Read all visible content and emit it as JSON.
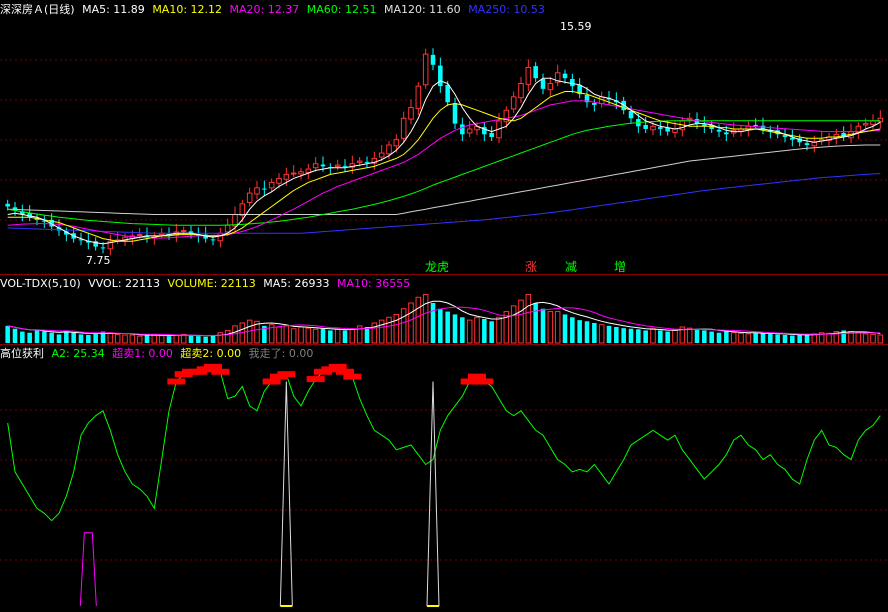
{
  "price_panel": {
    "title": "深深房Ａ(日线)",
    "legend": [
      {
        "label": "MA5: 11.89",
        "color": "#ffffff"
      },
      {
        "label": "MA10: 12.12",
        "color": "#ffff00"
      },
      {
        "label": "MA20: 12.37",
        "color": "#ff00ff"
      },
      {
        "label": "MA60: 12.51",
        "color": "#00ff00"
      },
      {
        "label": "MA120: 11.60",
        "color": "#e0e0e0"
      },
      {
        "label": "MA250: 10.53",
        "color": "#3333ff"
      }
    ],
    "annotations": {
      "high": "15.59",
      "low": "7.75"
    },
    "tags": [
      {
        "label": "龙虎",
        "color": "#00ff00"
      },
      {
        "label": "涨",
        "color": "#ff3333"
      },
      {
        "label": "减",
        "color": "#00ff00"
      },
      {
        "label": "增",
        "color": "#00ff00"
      }
    ]
  },
  "volume_panel": {
    "legend": [
      {
        "label": "VOL-TDX(5,10)",
        "color": "#ffffff"
      },
      {
        "label": "VVOL: 22113",
        "color": "#ffffff"
      },
      {
        "label": "VOLUME: 22113",
        "color": "#ffff00"
      },
      {
        "label": "MA5: 26933",
        "color": "#ffffff"
      },
      {
        "label": "MA10: 36555",
        "color": "#ff00ff"
      }
    ]
  },
  "indicator_panel": {
    "legend": [
      {
        "label": "高位获利",
        "color": "#ffffff"
      },
      {
        "label": "A2: 25.34",
        "color": "#00ff00"
      },
      {
        "label": "超卖1: 0.00",
        "color": "#ff00ff"
      },
      {
        "label": "超卖2: 0.00",
        "color": "#ffff00"
      },
      {
        "label": "我走了: 0.00",
        "color": "#808080"
      }
    ]
  },
  "chart_data": {
    "type": "candlestick",
    "price_range": [
      7.0,
      16.2
    ],
    "bars": 120,
    "close": [
      9.3,
      9.15,
      9.0,
      8.9,
      8.8,
      8.75,
      8.55,
      8.4,
      8.25,
      8.1,
      8.05,
      7.95,
      7.8,
      7.75,
      8.0,
      8.05,
      8.15,
      8.2,
      8.25,
      8.15,
      8.2,
      8.3,
      8.25,
      8.35,
      8.4,
      8.3,
      8.2,
      8.1,
      8.05,
      8.3,
      8.6,
      9.0,
      9.4,
      9.8,
      10.0,
      9.95,
      10.2,
      10.35,
      10.5,
      10.55,
      10.6,
      10.7,
      10.9,
      10.8,
      10.75,
      10.85,
      10.8,
      10.9,
      11.0,
      10.95,
      11.1,
      11.3,
      11.6,
      11.8,
      12.6,
      13.0,
      13.8,
      15.0,
      14.6,
      13.8,
      13.2,
      12.4,
      12.0,
      12.2,
      12.3,
      12.0,
      11.9,
      12.5,
      12.9,
      13.4,
      13.9,
      14.5,
      14.1,
      13.7,
      13.9,
      14.3,
      14.1,
      13.8,
      13.5,
      13.2,
      13.1,
      13.4,
      13.3,
      13.2,
      12.9,
      12.6,
      12.3,
      12.2,
      12.3,
      12.2,
      12.1,
      12.2,
      12.5,
      12.6,
      12.4,
      12.3,
      12.2,
      12.1,
      12.0,
      12.15,
      12.2,
      12.3,
      12.35,
      12.2,
      12.1,
      12.0,
      11.9,
      11.8,
      11.7,
      11.6,
      11.7,
      11.8,
      11.9,
      12.0,
      11.9,
      12.1,
      12.3,
      12.4,
      12.5,
      12.6
    ],
    "ma5": [
      9.0,
      9.05,
      9.0,
      8.95,
      8.9,
      8.8,
      8.65,
      8.5,
      8.35,
      8.2,
      8.1,
      8.0,
      7.95,
      7.9,
      7.95,
      8.0,
      8.05,
      8.1,
      8.15,
      8.2,
      8.2,
      8.2,
      8.25,
      8.3,
      8.3,
      8.3,
      8.25,
      8.2,
      8.15,
      8.2,
      8.3,
      8.5,
      8.8,
      9.2,
      9.5,
      9.7,
      9.85,
      10.05,
      10.2,
      10.35,
      10.45,
      10.55,
      10.65,
      10.7,
      10.75,
      10.75,
      10.75,
      10.8,
      10.85,
      10.9,
      10.95,
      11.05,
      11.2,
      11.4,
      11.7,
      12.1,
      12.6,
      13.3,
      13.8,
      14.0,
      13.9,
      13.5,
      13.0,
      12.6,
      12.3,
      12.2,
      12.1,
      12.2,
      12.3,
      12.6,
      13.0,
      13.5,
      13.9,
      14.1,
      14.1,
      14.0,
      13.95,
      13.9,
      13.85,
      13.7,
      13.5,
      13.4,
      13.35,
      13.25,
      13.1,
      12.9,
      12.7,
      12.5,
      12.4,
      12.3,
      12.25,
      12.2,
      12.25,
      12.35,
      12.4,
      12.4,
      12.35,
      12.25,
      12.15,
      12.1,
      12.1,
      12.15,
      12.2,
      12.2,
      12.15,
      12.1,
      12.0,
      11.9,
      11.8,
      11.75,
      11.7,
      11.75,
      11.8,
      11.85,
      11.9,
      11.95,
      12.05,
      12.2,
      12.3,
      12.45
    ],
    "ma10": [
      8.9,
      8.9,
      8.9,
      8.9,
      8.85,
      8.8,
      8.75,
      8.7,
      8.6,
      8.5,
      8.4,
      8.3,
      8.2,
      8.1,
      8.05,
      8.0,
      8.0,
      8.0,
      8.05,
      8.1,
      8.15,
      8.2,
      8.2,
      8.25,
      8.25,
      8.25,
      8.25,
      8.2,
      8.2,
      8.2,
      8.25,
      8.35,
      8.5,
      8.7,
      8.9,
      9.1,
      9.3,
      9.5,
      9.7,
      9.9,
      10.05,
      10.2,
      10.3,
      10.4,
      10.5,
      10.55,
      10.6,
      10.65,
      10.7,
      10.75,
      10.8,
      10.9,
      11.0,
      11.1,
      11.25,
      11.5,
      11.8,
      12.2,
      12.6,
      12.9,
      13.1,
      13.15,
      13.1,
      13.0,
      12.9,
      12.8,
      12.7,
      12.6,
      12.55,
      12.5,
      12.6,
      12.8,
      13.0,
      13.2,
      13.4,
      13.5,
      13.6,
      13.6,
      13.55,
      13.5,
      13.4,
      13.3,
      13.2,
      13.1,
      13.0,
      12.9,
      12.8,
      12.7,
      12.6,
      12.5,
      12.45,
      12.4,
      12.35,
      12.3,
      12.3,
      12.3,
      12.3,
      12.25,
      12.25,
      12.2,
      12.2,
      12.2,
      12.2,
      12.15,
      12.1,
      12.05,
      12.0,
      11.95,
      11.9,
      11.85,
      11.85,
      11.85,
      11.9,
      11.9,
      11.95,
      12.0,
      12.05,
      12.1,
      12.15,
      12.2
    ],
    "ma20": [
      8.6,
      8.62,
      8.64,
      8.65,
      8.66,
      8.66,
      8.65,
      8.63,
      8.6,
      8.56,
      8.5,
      8.45,
      8.4,
      8.35,
      8.3,
      8.25,
      8.2,
      8.17,
      8.15,
      8.13,
      8.12,
      8.12,
      8.13,
      8.15,
      8.17,
      8.19,
      8.2,
      8.21,
      8.22,
      8.23,
      8.25,
      8.3,
      8.37,
      8.45,
      8.55,
      8.67,
      8.8,
      8.93,
      9.07,
      9.2,
      9.35,
      9.5,
      9.65,
      9.8,
      9.92,
      10.05,
      10.15,
      10.25,
      10.35,
      10.45,
      10.55,
      10.65,
      10.75,
      10.85,
      10.95,
      11.1,
      11.25,
      11.45,
      11.65,
      11.85,
      12.0,
      12.15,
      12.25,
      12.35,
      12.4,
      12.45,
      12.5,
      12.55,
      12.6,
      12.65,
      12.7,
      12.8,
      12.9,
      13.0,
      13.1,
      13.15,
      13.2,
      13.25,
      13.25,
      13.25,
      13.2,
      13.15,
      13.1,
      13.05,
      13.0,
      12.95,
      12.9,
      12.85,
      12.8,
      12.75,
      12.7,
      12.65,
      12.6,
      12.55,
      12.5,
      12.47,
      12.44,
      12.41,
      12.38,
      12.35,
      12.33,
      12.31,
      12.29,
      12.27,
      12.25,
      12.23,
      12.21,
      12.19,
      12.17,
      12.15,
      12.13,
      12.11,
      12.1,
      12.1,
      12.1,
      12.1,
      12.11,
      12.12,
      12.13,
      12.15
    ],
    "ma60": [
      9.2,
      9.15,
      9.1,
      9.06,
      9.02,
      8.98,
      8.94,
      8.9,
      8.87,
      8.84,
      8.81,
      8.78,
      8.76,
      8.74,
      8.72,
      8.7,
      8.68,
      8.66,
      8.65,
      8.64,
      8.63,
      8.62,
      8.61,
      8.6,
      8.6,
      8.6,
      8.6,
      8.6,
      8.6,
      8.6,
      8.61,
      8.62,
      8.63,
      8.65,
      8.67,
      8.69,
      8.72,
      8.75,
      8.78,
      8.82,
      8.86,
      8.9,
      8.95,
      9.0,
      9.05,
      9.1,
      9.15,
      9.2,
      9.26,
      9.32,
      9.38,
      9.45,
      9.52,
      9.6,
      9.68,
      9.77,
      9.87,
      9.98,
      10.1,
      10.2,
      10.3,
      10.4,
      10.5,
      10.6,
      10.7,
      10.8,
      10.9,
      11.0,
      11.1,
      11.2,
      11.3,
      11.4,
      11.5,
      11.6,
      11.7,
      11.8,
      11.9,
      12.0,
      12.08,
      12.15,
      12.2,
      12.25,
      12.3,
      12.34,
      12.38,
      12.41,
      12.44,
      12.46,
      12.48,
      12.49,
      12.5,
      12.51,
      12.51,
      12.51,
      12.51,
      12.51,
      12.51,
      12.51,
      12.51,
      12.51,
      12.51,
      12.51,
      12.51,
      12.51,
      12.51,
      12.51,
      12.51,
      12.51,
      12.51,
      12.51,
      12.51,
      12.51,
      12.51,
      12.51,
      12.51,
      12.51,
      12.51,
      12.51,
      12.51,
      12.51
    ],
    "ma120": [
      9.2,
      9.19,
      9.18,
      9.17,
      9.16,
      9.15,
      9.14,
      9.13,
      9.12,
      9.11,
      9.1,
      9.09,
      9.08,
      9.07,
      9.06,
      9.05,
      9.04,
      9.03,
      9.02,
      9.01,
      9.0,
      9.0,
      9.0,
      9.0,
      9.0,
      9.0,
      9.0,
      9.0,
      9.0,
      9.0,
      9.0,
      9.0,
      9.0,
      9.0,
      9.0,
      9.0,
      9.0,
      9.0,
      9.0,
      9.0,
      9.0,
      9.0,
      9.0,
      9.0,
      9.0,
      9.0,
      9.0,
      9.0,
      9.0,
      9.0,
      9.0,
      9.0,
      9.0,
      9.0,
      9.05,
      9.1,
      9.15,
      9.2,
      9.25,
      9.3,
      9.35,
      9.4,
      9.45,
      9.5,
      9.55,
      9.6,
      9.65,
      9.7,
      9.75,
      9.8,
      9.85,
      9.9,
      9.95,
      10.0,
      10.05,
      10.1,
      10.15,
      10.2,
      10.25,
      10.3,
      10.35,
      10.4,
      10.45,
      10.5,
      10.55,
      10.6,
      10.65,
      10.7,
      10.75,
      10.8,
      10.85,
      10.9,
      10.95,
      11.0,
      11.03,
      11.06,
      11.09,
      11.12,
      11.15,
      11.18,
      11.21,
      11.24,
      11.27,
      11.3,
      11.33,
      11.36,
      11.39,
      11.42,
      11.45,
      11.48,
      11.5,
      11.52,
      11.54,
      11.56,
      11.57,
      11.58,
      11.59,
      11.6,
      11.6,
      11.6
    ],
    "ma250": [
      8.5,
      8.49,
      8.48,
      8.47,
      8.46,
      8.45,
      8.44,
      8.43,
      8.42,
      8.41,
      8.4,
      8.39,
      8.38,
      8.37,
      8.36,
      8.35,
      8.34,
      8.33,
      8.32,
      8.31,
      8.3,
      8.3,
      8.3,
      8.3,
      8.3,
      8.3,
      8.3,
      8.3,
      8.3,
      8.3,
      8.3,
      8.3,
      8.3,
      8.3,
      8.3,
      8.3,
      8.3,
      8.3,
      8.3,
      8.3,
      8.3,
      8.32,
      8.34,
      8.36,
      8.38,
      8.4,
      8.42,
      8.44,
      8.46,
      8.48,
      8.5,
      8.52,
      8.54,
      8.56,
      8.58,
      8.6,
      8.62,
      8.64,
      8.66,
      8.68,
      8.7,
      8.72,
      8.74,
      8.76,
      8.78,
      8.8,
      8.83,
      8.86,
      8.89,
      8.92,
      8.95,
      8.98,
      9.01,
      9.04,
      9.07,
      9.1,
      9.14,
      9.18,
      9.22,
      9.26,
      9.3,
      9.34,
      9.38,
      9.42,
      9.46,
      9.5,
      9.54,
      9.58,
      9.62,
      9.66,
      9.7,
      9.74,
      9.78,
      9.82,
      9.86,
      9.9,
      9.93,
      9.96,
      9.99,
      10.02,
      10.05,
      10.08,
      10.11,
      10.14,
      10.17,
      10.2,
      10.23,
      10.26,
      10.29,
      10.32,
      10.35,
      10.38,
      10.4,
      10.42,
      10.44,
      10.46,
      10.48,
      10.5,
      10.52,
      10.53
    ],
    "volume": [
      30,
      25,
      20,
      18,
      22,
      20,
      18,
      15,
      22,
      18,
      15,
      14,
      16,
      20,
      18,
      15,
      14,
      14,
      12,
      15,
      14,
      13,
      12,
      14,
      15,
      13,
      12,
      11,
      14,
      18,
      22,
      30,
      35,
      40,
      38,
      30,
      32,
      28,
      30,
      25,
      28,
      26,
      24,
      25,
      22,
      24,
      22,
      25,
      30,
      28,
      35,
      40,
      45,
      50,
      60,
      70,
      80,
      85,
      70,
      60,
      55,
      50,
      45,
      40,
      45,
      42,
      38,
      45,
      55,
      65,
      75,
      85,
      70,
      60,
      55,
      55,
      50,
      45,
      40,
      38,
      35,
      32,
      30,
      28,
      26,
      25,
      24,
      22,
      25,
      22,
      20,
      22,
      28,
      26,
      24,
      22,
      20,
      18,
      20,
      18,
      17,
      16,
      18,
      17,
      16,
      15,
      14,
      13,
      14,
      15,
      16,
      18,
      17,
      20,
      22,
      20,
      18,
      16,
      15,
      14
    ],
    "indicator": [
      75,
      55,
      50,
      45,
      40,
      38,
      35,
      38,
      45,
      55,
      70,
      75,
      78,
      80,
      72,
      62,
      55,
      50,
      48,
      45,
      40,
      60,
      80,
      92,
      95,
      96,
      96,
      97,
      98,
      96,
      85,
      86,
      90,
      82,
      80,
      88,
      92,
      94,
      95,
      86,
      82,
      88,
      93,
      96,
      97,
      98,
      96,
      94,
      85,
      78,
      72,
      70,
      68,
      64,
      65,
      66,
      62,
      58,
      60,
      72,
      78,
      82,
      86,
      92,
      94,
      92,
      90,
      85,
      80,
      78,
      80,
      76,
      72,
      70,
      65,
      60,
      58,
      55,
      56,
      55,
      58,
      54,
      50,
      55,
      60,
      66,
      68,
      70,
      72,
      70,
      68,
      70,
      64,
      60,
      56,
      52,
      55,
      58,
      62,
      68,
      70,
      66,
      64,
      60,
      62,
      58,
      56,
      52,
      50,
      60,
      68,
      72,
      66,
      65,
      62,
      60,
      68,
      72,
      74,
      78
    ]
  }
}
